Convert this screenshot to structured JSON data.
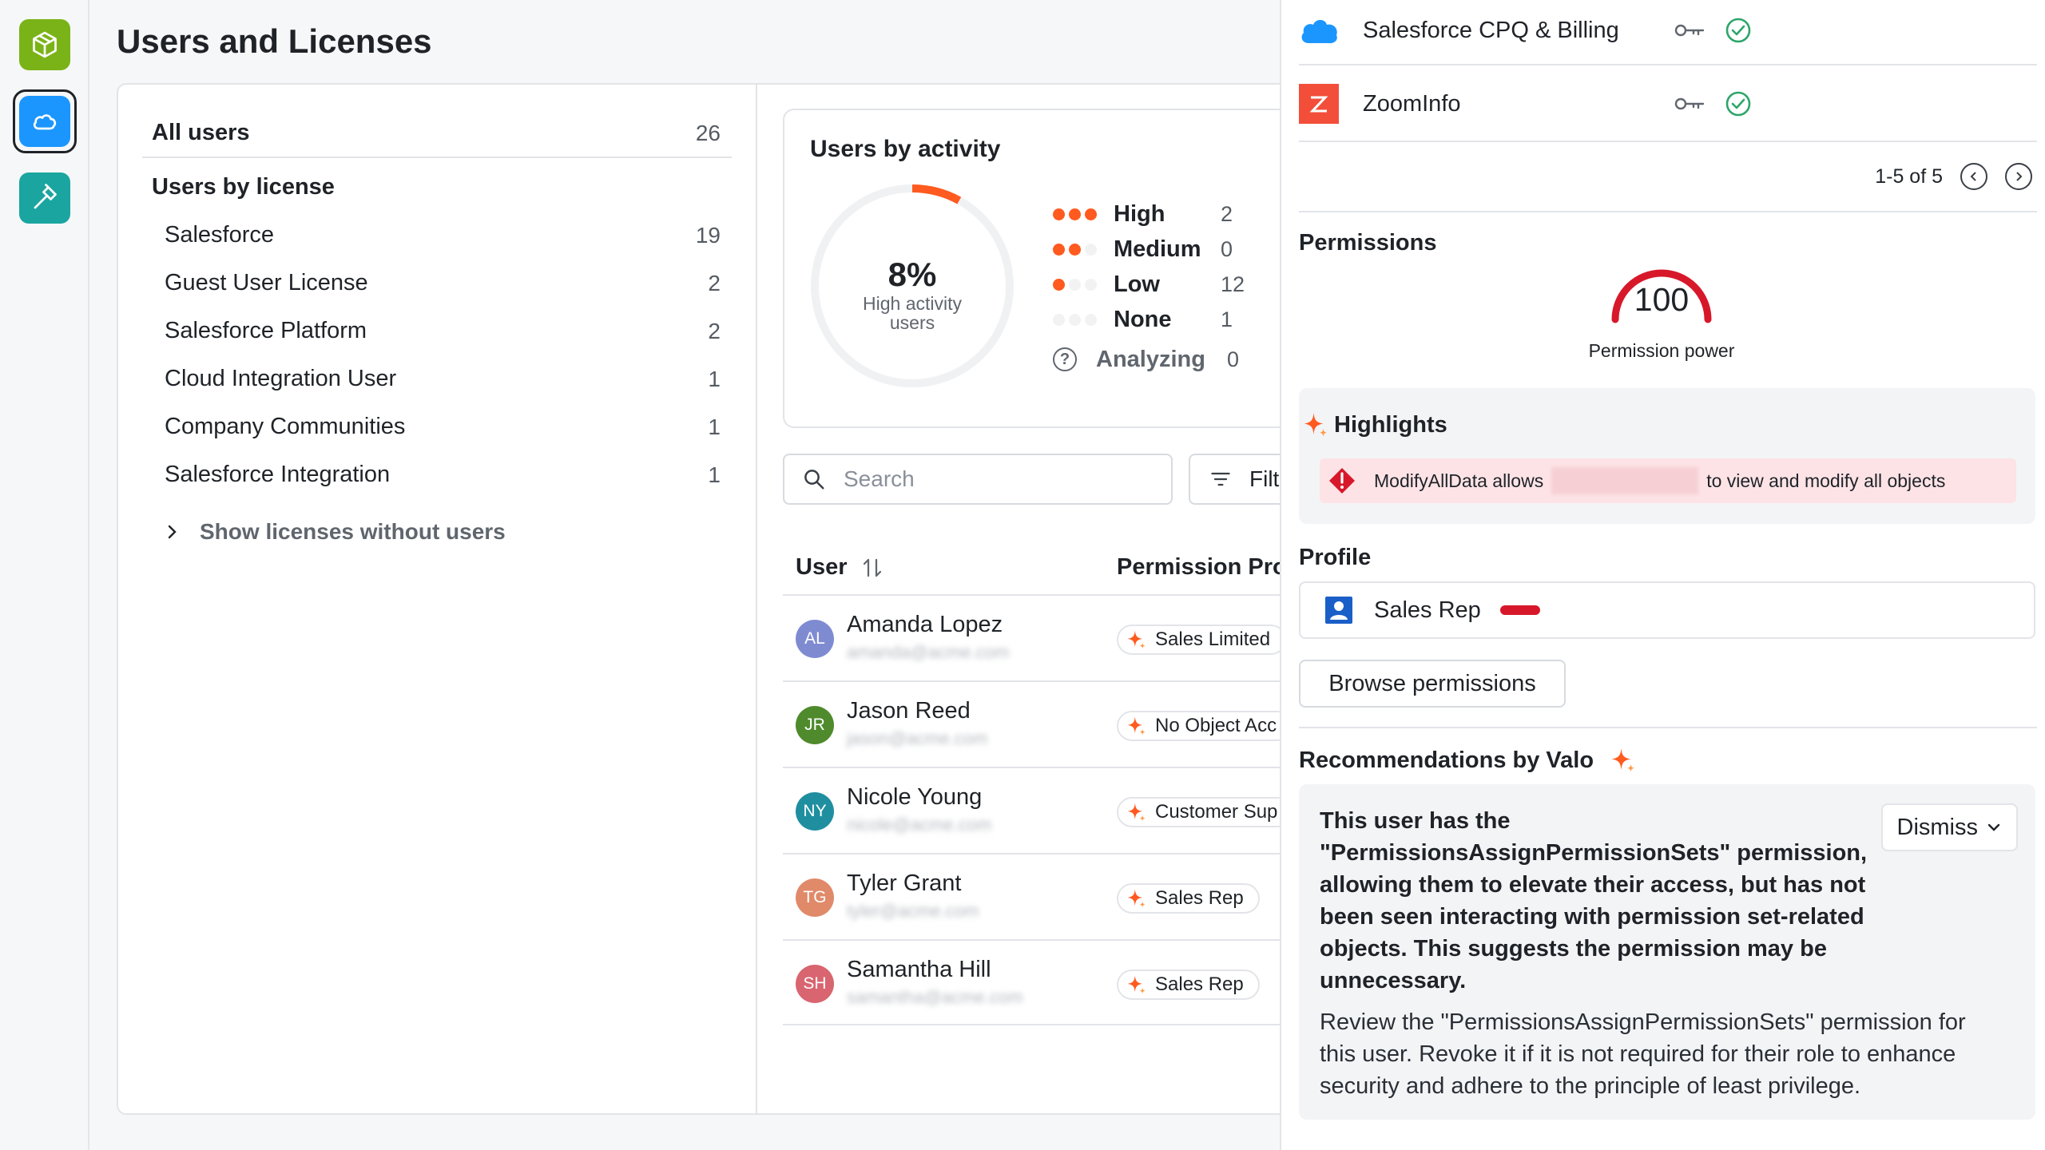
{
  "page": {
    "title": "Users and Licenses"
  },
  "licenses": {
    "all_users_label": "All users",
    "all_users_count": "26",
    "by_license_label": "Users by license",
    "items": [
      {
        "label": "Salesforce",
        "count": "19"
      },
      {
        "label": "Guest User License",
        "count": "2"
      },
      {
        "label": "Salesforce Platform",
        "count": "2"
      },
      {
        "label": "Cloud Integration User",
        "count": "1"
      },
      {
        "label": "Company Communities",
        "count": "1"
      },
      {
        "label": "Salesforce Integration",
        "count": "1"
      }
    ],
    "show_without_users": "Show licenses without users"
  },
  "activity": {
    "title": "Users by activity",
    "percent": "8%",
    "percent_value": 8,
    "percent_label_line1": "High activity",
    "percent_label_line2": "users",
    "levels": [
      {
        "label": "High",
        "count": "2",
        "dots": 3
      },
      {
        "label": "Medium",
        "count": "0",
        "dots": 2
      },
      {
        "label": "Low",
        "count": "12",
        "dots": 1
      },
      {
        "label": "None",
        "count": "1",
        "dots": 0
      }
    ],
    "analyzing_label": "Analyzing",
    "analyzing_count": "0",
    "accent_color": "#ff5a1f"
  },
  "toolbar": {
    "search_placeholder": "Search",
    "filter_label": "Filte"
  },
  "table": {
    "col_user": "User",
    "col_permission": "Permission Prof",
    "rows": [
      {
        "initials": "AL",
        "name": "Amanda Lopez",
        "email": "amanda@acme.com",
        "permission": "Sales Limited",
        "color": "#7f8bd1"
      },
      {
        "initials": "JR",
        "name": "Jason Reed",
        "email": "jason@acme.com",
        "permission": "No Object Acc",
        "color": "#4f8a2c"
      },
      {
        "initials": "NY",
        "name": "Nicole Young",
        "email": "nicole@acme.com",
        "permission": "Customer Sup",
        "color": "#1f8fa0"
      },
      {
        "initials": "TG",
        "name": "Tyler Grant",
        "email": "tyler@acme.com",
        "permission": "Sales Rep",
        "color": "#e08a6a"
      },
      {
        "initials": "SH",
        "name": "Samantha Hill",
        "email": "samantha@acme.com",
        "permission": "Sales Rep",
        "color": "#d8656f"
      }
    ]
  },
  "panel": {
    "integrations": [
      {
        "name": "Salesforce CPQ & Billing",
        "icon": "cloud-icon"
      },
      {
        "name": "ZoomInfo",
        "icon": "zoominfo-logo-icon"
      }
    ],
    "pager": "1-5 of 5",
    "permissions_title": "Permissions",
    "permission_power_value": "100",
    "permission_power_label": "Permission power",
    "highlights_title": "Highlights",
    "highlight_prefix": "ModifyAllData allows",
    "highlight_suffix": "to view and modify all objects",
    "profile_title": "Profile",
    "profile_name": "Sales Rep",
    "browse_label": "Browse permissions",
    "rec_title": "Recommendations by Valo",
    "rec_heading": "This user has the \"PermissionsAssignPermissionSets\" permission, allowing them to elevate their access, but has not been seen interacting with permission set-related objects. This suggests the permission may be unnecessary.",
    "rec_body": "Review the \"PermissionsAssignPermissionSets\" permission for this user. Revoke it if it is not required for their role to enhance security and adhere to the principle of least privilege.",
    "dismiss_label": "Dismiss"
  }
}
